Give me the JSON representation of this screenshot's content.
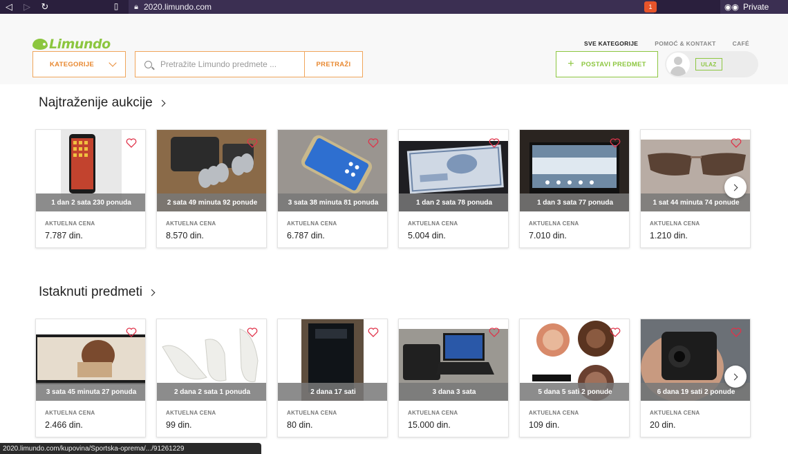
{
  "browser": {
    "url": "2020.limundo.com",
    "private_label": "Private",
    "shield_count": "1"
  },
  "header": {
    "logo": "Limundo",
    "links": [
      "SVE KATEGORIJE",
      "POMOĆ & KONTAKT",
      "CAFÉ"
    ],
    "kategorije_label": "KATEGORIJE",
    "search_placeholder": "Pretražite Limundo predmete ...",
    "search_button": "PRETRAŽI",
    "post_button": "POSTAVI PREDMET",
    "login_button": "ULAZ"
  },
  "sections": [
    {
      "title": "Najtraženije aukcije",
      "items": [
        {
          "time": "1 dan 2 sata  230 ponuda",
          "label": "AKTUELNA CENA",
          "price": "7.787 din."
        },
        {
          "time": "2 sata 49 minuta  92 ponude",
          "label": "AKTUELNA CENA",
          "price": "8.570 din."
        },
        {
          "time": "3 sata 38 minuta  81 ponuda",
          "label": "AKTUELNA CENA",
          "price": "6.787 din."
        },
        {
          "time": "1 dan 2 sata  78 ponuda",
          "label": "AKTUELNA CENA",
          "price": "5.004 din."
        },
        {
          "time": "1 dan 3 sata  77 ponuda",
          "label": "AKTUELNA CENA",
          "price": "7.010 din."
        },
        {
          "time": "1 sat 44 minuta  74 ponude",
          "label": "AKTUELNA CENA",
          "price": "1.210 din."
        }
      ]
    },
    {
      "title": "Istaknuti predmeti",
      "items": [
        {
          "time": "3 sata 45 minuta  27 ponuda",
          "label": "AKTUELNA CENA",
          "price": "2.466 din."
        },
        {
          "time": "2 dana 2 sata  1 ponuda",
          "label": "AKTUELNA CENA",
          "price": "99 din."
        },
        {
          "time": "2 dana 17 sati",
          "label": "AKTUELNA CENA",
          "price": "80 din."
        },
        {
          "time": "3 dana 3 sata",
          "label": "AKTUELNA CENA",
          "price": "15.000 din."
        },
        {
          "time": "5 dana 5 sati  2 ponude",
          "label": "AKTUELNA CENA",
          "price": "109 din."
        },
        {
          "time": "6 dana 19 sati  2 ponude",
          "label": "AKTUELNA CENA",
          "price": "20 din."
        }
      ]
    }
  ],
  "status_url": "2020.limundo.com/kupovina/Sportska-oprema/.../91261229",
  "colors": {
    "accent_orange": "#e8872e",
    "accent_green": "#8cc63f",
    "heart_red": "#e0334a"
  }
}
